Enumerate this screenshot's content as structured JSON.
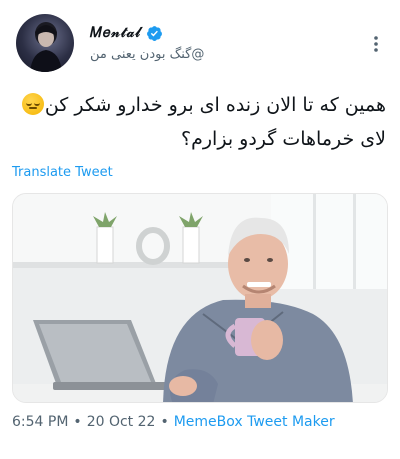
{
  "user": {
    "display_name": "𝑀𝑒𝓃𝓉𝒶𝓁",
    "handle": "@گنگ بودن یعنی من"
  },
  "tweet": {
    "text_line1": "همین که تا الان زنده ای برو خدارو شکر کن",
    "text_line2": "لای خرماهات گردو بزارم؟",
    "translate_label": "Translate Tweet"
  },
  "meta": {
    "time": "6:54 PM",
    "sep1": "•",
    "date": "20 Oct 22",
    "sep2": "•",
    "source": "MemeBox Tweet Maker"
  },
  "colors": {
    "accent": "#1d9bf0",
    "secondary_text": "#536471",
    "verified": "#1d9bf0"
  },
  "icons": {
    "verified": "verified-badge-icon",
    "more": "more-vertical-icon",
    "emoji": "pensive-face-emoji"
  }
}
